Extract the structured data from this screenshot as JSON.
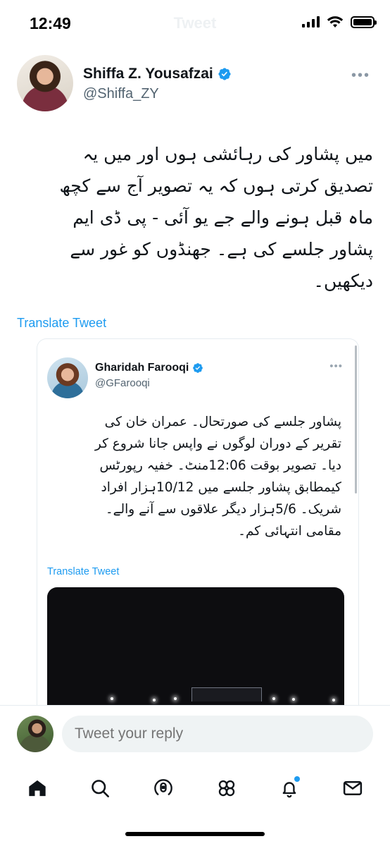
{
  "status_bar": {
    "time": "12:49",
    "screen_title": "Tweet"
  },
  "tweet": {
    "author": {
      "name": "Shiffa Z. Yousafzai",
      "handle": "@Shiffa_ZY",
      "verified": true
    },
    "text_lines": [
      "میں پشاور کی رہائشی ہوں اور میں یہ",
      "تصدیق کرتی ہوں کہ یہ تصویر آج سے کچھ",
      "ماہ قبل ہونے والے جے یو آئی - پی ڈی ایم",
      "پشاور جلسے کی ہے۔ جھنڈوں کو غور سے",
      "دیکھیں۔"
    ],
    "translate_label": "Translate Tweet"
  },
  "quoted_tweet": {
    "author": {
      "name": "Gharidah Farooqi",
      "handle": "@GFarooqi",
      "verified": true
    },
    "text_lines": [
      "پشاور جلسے کی صورتحال۔ عمران خان کی",
      "تقریر کے دوران لوگوں نے واپس جانا شروع کر",
      "دیا۔ تصویر بوقت 12:06منٹ۔ خفیہ رپورٹس",
      "کیمطابق پشاور جلسے میں 10/12ہزار افراد",
      "شریک۔ 5/6ہزار دیگر علاقوں سے آنے والے۔",
      "مقامی انتہائی کم۔"
    ],
    "translate_label": "Translate Tweet"
  },
  "reply": {
    "placeholder": "Tweet your reply"
  },
  "bottom_nav": {
    "items": [
      "home-icon",
      "search-icon",
      "spaces-icon",
      "communities-icon",
      "notifications-icon",
      "messages-icon"
    ],
    "notification_dot": true
  },
  "colors": {
    "accent": "#1d9bf0",
    "text_primary": "#0f1419",
    "text_secondary": "#536471",
    "input_bg": "#eff3f4"
  }
}
